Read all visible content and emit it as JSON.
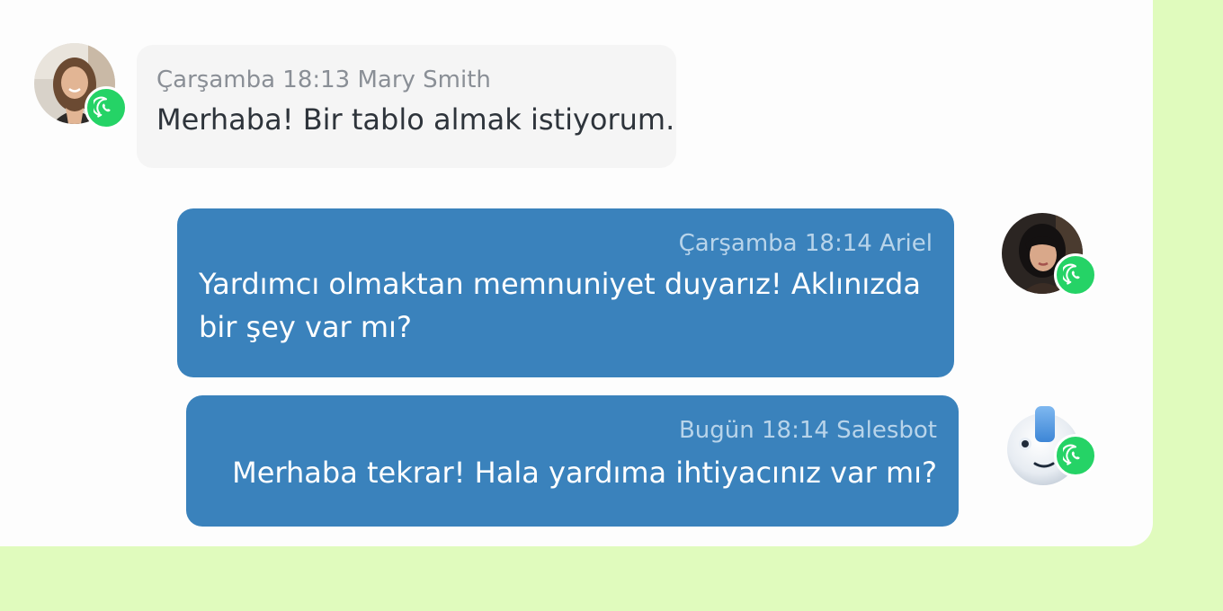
{
  "colors": {
    "page_background": "#e0fbbd",
    "panel_background": "#fdfdfd",
    "incoming_bubble": "#f5f5f5",
    "outgoing_bubble": "#3a82bc",
    "whatsapp_green": "#25d366"
  },
  "messages": [
    {
      "direction": "incoming",
      "meta": "Çarşamba 18:13 Mary Smith",
      "text": "Merhaba! Bir tablo almak istiyorum.",
      "avatar": "user-photo",
      "channel_icon": "whatsapp-icon"
    },
    {
      "direction": "outgoing",
      "meta": "Çarşamba 18:14 Ariel",
      "text": "Yardımcı olmaktan memnuniyet duyarız! Aklınızda bir şey var mı?",
      "avatar": "agent-photo",
      "channel_icon": "whatsapp-icon"
    },
    {
      "direction": "outgoing",
      "meta": "Bugün 18:14 Salesbot",
      "text": "Merhaba tekrar! Hala yardıma ihtiyacınız var mı?",
      "avatar": "bot-avatar",
      "channel_icon": "whatsapp-icon"
    }
  ]
}
